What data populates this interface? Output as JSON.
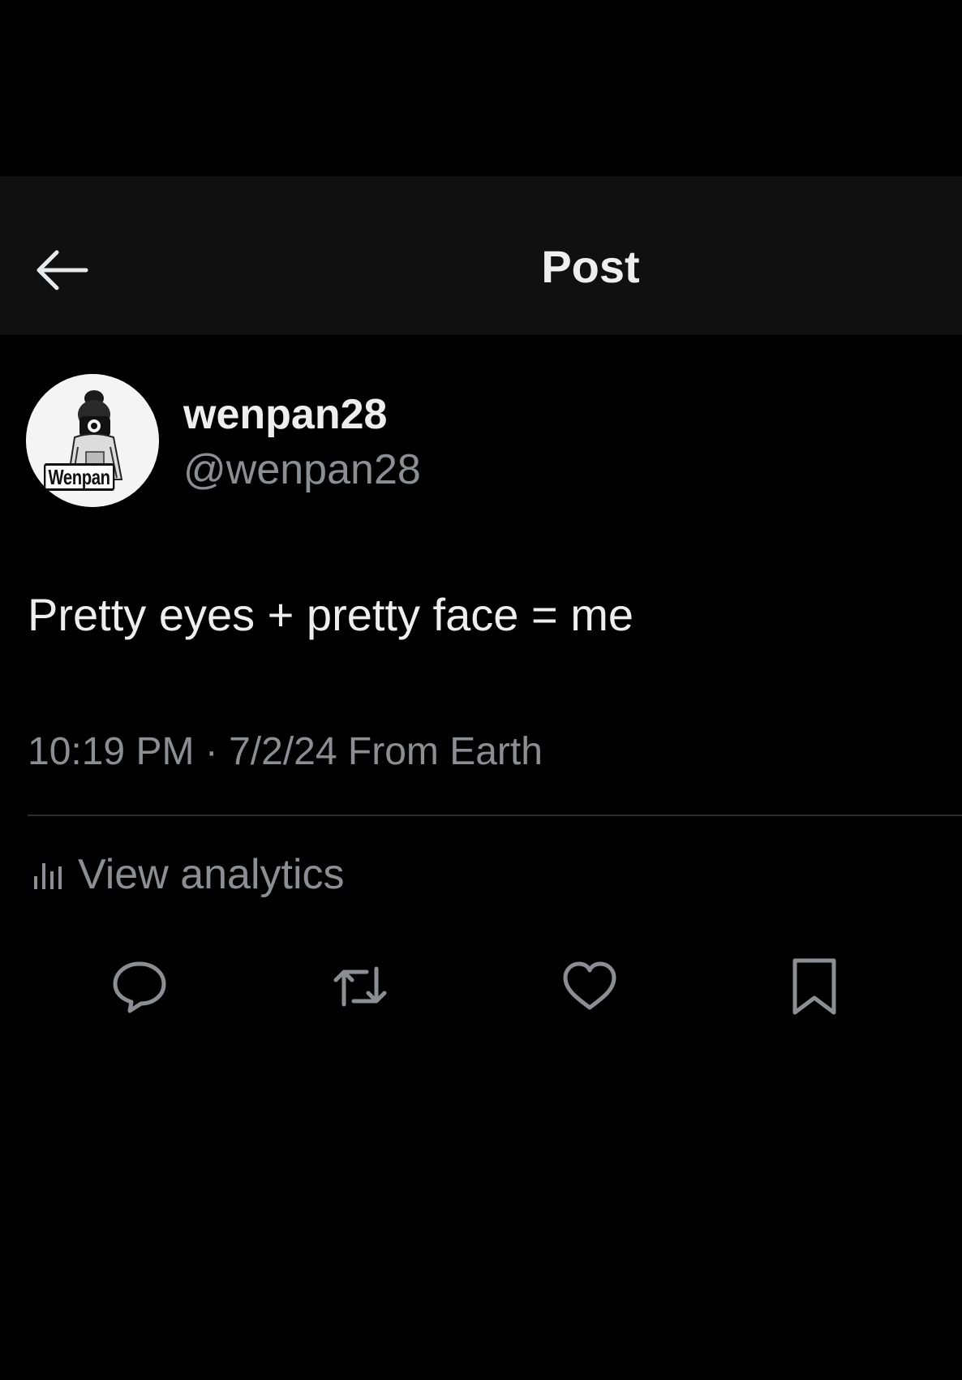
{
  "header": {
    "back_icon": "arrow-left-icon",
    "title": "Post"
  },
  "author": {
    "avatar_badge": "Wenpan",
    "display_name": "wenpan28",
    "handle": "@wenpan28"
  },
  "post": {
    "text": "Pretty eyes + pretty face = me",
    "timestamp": "10:19 PM · 7/2/24 From Earth"
  },
  "analytics": {
    "icon": "bar-chart-icon",
    "label": "View analytics"
  },
  "actions": [
    {
      "name": "reply",
      "icon": "speech-bubble-icon"
    },
    {
      "name": "repost",
      "icon": "repost-arrows-icon"
    },
    {
      "name": "like",
      "icon": "heart-icon"
    },
    {
      "name": "bookmark",
      "icon": "bookmark-icon"
    }
  ],
  "colors": {
    "background": "#000000",
    "header_background": "#101010",
    "primary_text": "#eeeeee",
    "secondary_text": "#8b8f94",
    "divider": "#2a2d30"
  }
}
